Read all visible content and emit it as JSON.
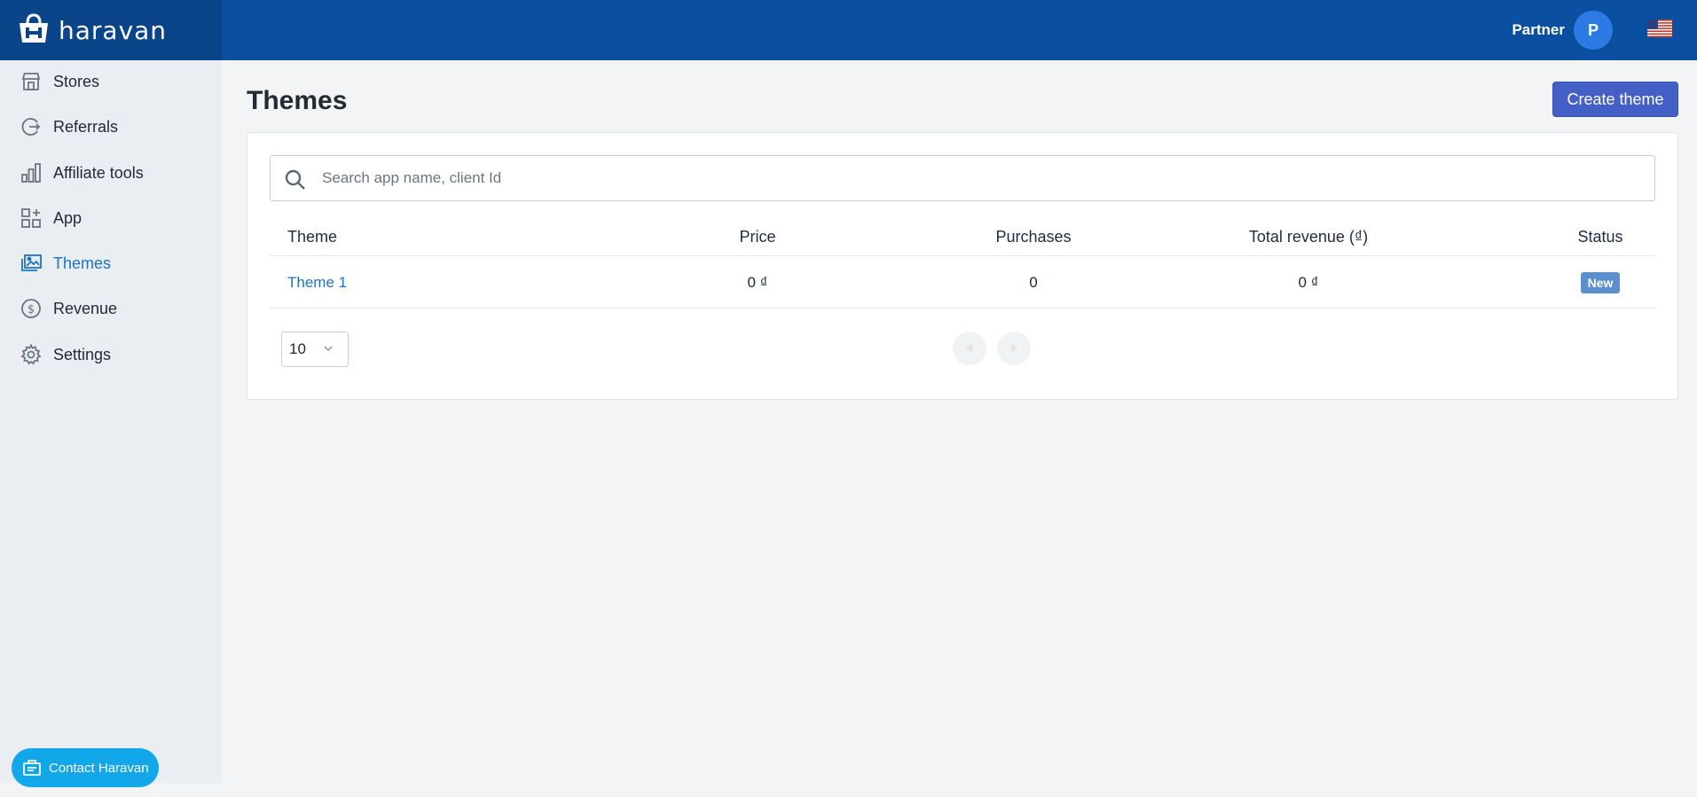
{
  "brand": {
    "name": "haravan"
  },
  "header": {
    "partner_label": "Partner",
    "avatar_initial": "P"
  },
  "sidebar": {
    "items": [
      {
        "label": "Stores",
        "icon": "store-icon"
      },
      {
        "label": "Referrals",
        "icon": "referral-icon"
      },
      {
        "label": "Affiliate tools",
        "icon": "chart-bar-icon"
      },
      {
        "label": "App",
        "icon": "apps-grid-icon"
      },
      {
        "label": "Themes",
        "icon": "themes-icon",
        "active": true
      },
      {
        "label": "Revenue",
        "icon": "dollar-circle-icon"
      },
      {
        "label": "Settings",
        "icon": "gear-icon"
      }
    ],
    "contact_label": "Contact Haravan"
  },
  "page": {
    "title": "Themes",
    "create_button": "Create theme"
  },
  "search": {
    "placeholder": "Search app name, client Id"
  },
  "table": {
    "columns": [
      "Theme",
      "Price",
      "Purchases",
      "Total revenue (₫)",
      "Status"
    ],
    "rows": [
      {
        "theme": "Theme 1",
        "price": "0 ₫",
        "purchases": "0",
        "revenue": "0 ₫",
        "status": "New"
      }
    ]
  },
  "pagination": {
    "page_size": "10"
  },
  "colors": {
    "topbar": "#0b4fa0",
    "accent": "#4460c7",
    "link": "#1a73c7",
    "status_new": "#5b8fd0",
    "contact": "#12a7e8"
  }
}
